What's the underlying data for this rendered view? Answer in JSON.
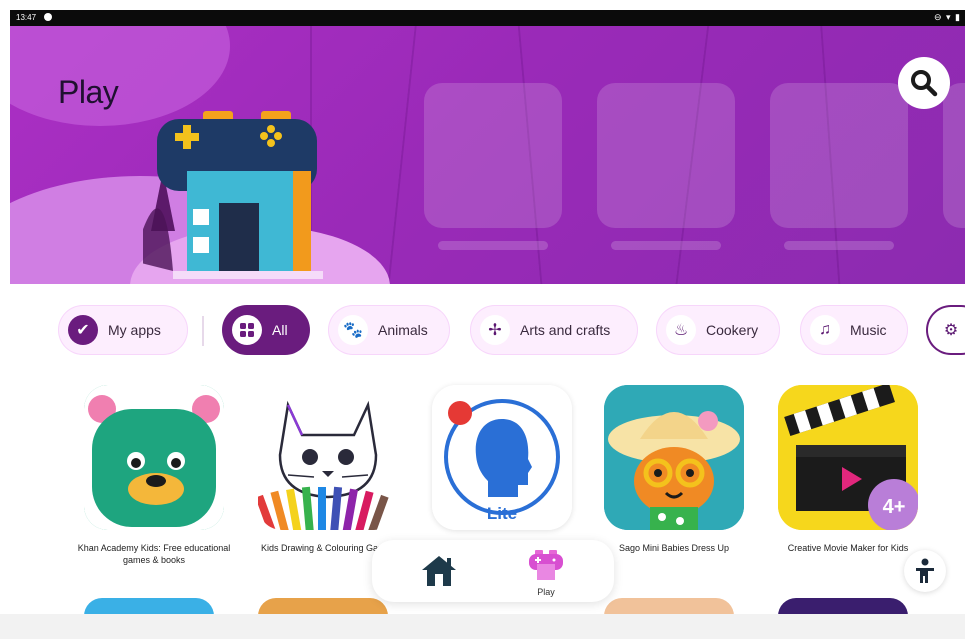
{
  "status_bar": {
    "time": "13:47",
    "right_icons": "⊖ ▾ ▮"
  },
  "header": {
    "title": "Play"
  },
  "categories": [
    {
      "label": "My apps",
      "icon": "check-circle-icon"
    },
    {
      "label": "All",
      "icon": "grid-icon",
      "active": true
    },
    {
      "label": "Animals",
      "icon": "paw-icon"
    },
    {
      "label": "Arts and crafts",
      "icon": "pinwheel-icon"
    },
    {
      "label": "Cookery",
      "icon": "pot-icon"
    },
    {
      "label": "Music",
      "icon": "music-note-icon"
    }
  ],
  "apps": [
    {
      "label": "Khan Academy Kids: Free educational games & books"
    },
    {
      "label": "Kids Drawing & Colouring Games"
    },
    {
      "label": "Lite",
      "icon_text": "Lite"
    },
    {
      "label": "Sago Mini Babies Dress Up"
    },
    {
      "label": "Creative Movie Maker for Kids",
      "badge": "4+"
    }
  ],
  "nav": {
    "play_label": "Play"
  },
  "colors": {
    "hero": "#9a2ab8",
    "active_pill": "#6a1c7e",
    "pill_bg": "#fdeefe"
  }
}
